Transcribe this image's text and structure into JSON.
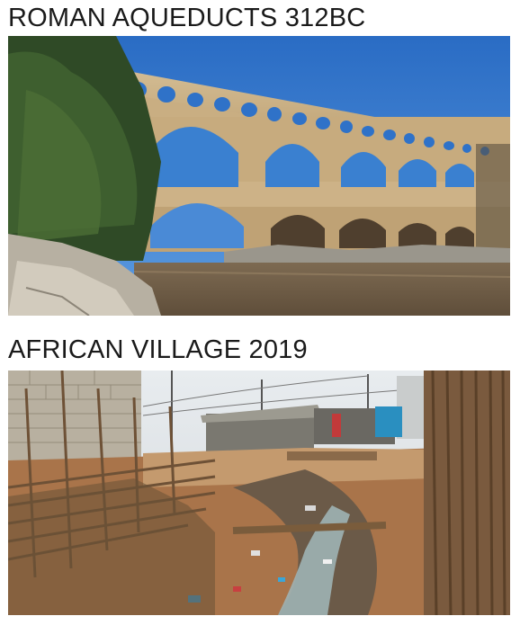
{
  "meme": {
    "top_caption": "ROMAN AQUEDUCTS 312BC",
    "bottom_caption": "AFRICAN VILLAGE 2019"
  },
  "colors": {
    "sky": "#2e73c9",
    "stone": "#cdb48a",
    "river": "#8a6f4e",
    "soil": "#a86a40"
  }
}
